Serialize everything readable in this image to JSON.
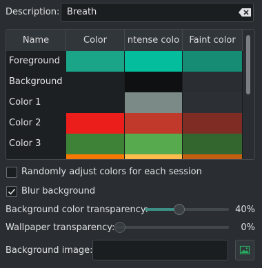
{
  "description": {
    "label": "Description:",
    "value": "Breath"
  },
  "table": {
    "headers": [
      "Name",
      "Color",
      "ntense colo",
      "Faint color"
    ],
    "rows": [
      {
        "name": "Foreground",
        "colors": [
          "#1aa488",
          "#03bd9c",
          "#178c74"
        ]
      },
      {
        "name": "Background",
        "colors": [
          "#1d2023",
          "#0e1012",
          "#2a2e33"
        ]
      },
      {
        "name": "Color 1",
        "colors": [
          "#1d2023",
          "#7b8a87",
          "#2c3034"
        ]
      },
      {
        "name": "Color 2",
        "colors": [
          "#ec1e1c",
          "#c0392b",
          "#7f2c24"
        ]
      },
      {
        "name": "Color 3",
        "colors": [
          "#3e8238",
          "#57aa4e",
          "#33652e"
        ]
      },
      {
        "name": "",
        "colors": [
          "#f57800",
          "#fdbc4b",
          "#c05f10"
        ]
      }
    ]
  },
  "options": {
    "random_colors": {
      "label": "Randomly adjust colors for each session",
      "checked": false
    },
    "blur_background": {
      "label": "Blur background",
      "checked": true
    }
  },
  "sliders": {
    "bg_transparency": {
      "label": "Background color transparency:",
      "value_text": "40%",
      "value": 0.4
    },
    "wallpaper_transparency": {
      "label": "Wallpaper transparency:",
      "value_text": "0%",
      "value": 0
    }
  },
  "background_image": {
    "label": "Background image:",
    "value": ""
  },
  "icons": {
    "clear": "clear-text-icon",
    "image": "image-icon",
    "check": "checkmark-icon"
  },
  "colors": {
    "accent": "#3daee9",
    "slider_fill": "#3d8f86"
  }
}
